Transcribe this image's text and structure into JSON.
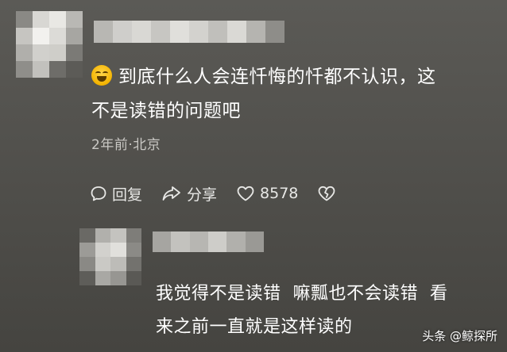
{
  "comment": {
    "emoji_name": "laugh-tears-emoji",
    "text_line1": "到底什么人会连忏悔的忏都不认识，这",
    "text_line2": "不是读错的问题吧",
    "meta": "2年前·北京",
    "actions": {
      "reply_label": "回复",
      "share_label": "分享",
      "like_count": "8578"
    }
  },
  "reply": {
    "text_line1": "我觉得不是读错  嘛瓢也不会读错  看",
    "text_line2": "来之前一直就是这样读的"
  },
  "watermark": "头条 @鲸探所",
  "colors": {
    "background": "#54534f",
    "text": "#ffffff",
    "meta_text": "#c9c8c4",
    "emoji": "#f4b400"
  }
}
